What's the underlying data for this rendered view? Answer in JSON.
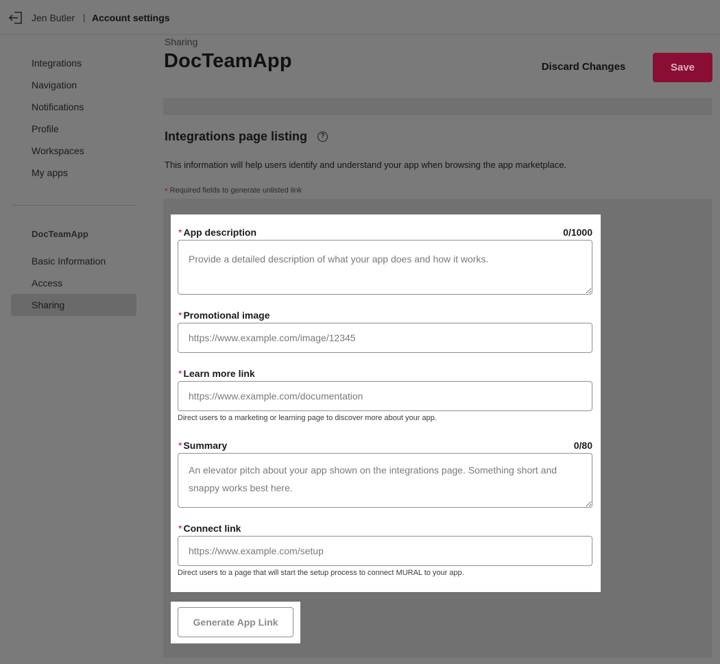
{
  "topbar": {
    "exit_icon": "exit-door-icon",
    "user_name": "Jen Butler",
    "separator": "|",
    "title": "Account settings"
  },
  "sidebar": {
    "items": [
      {
        "label": "Integrations"
      },
      {
        "label": "Navigation"
      },
      {
        "label": "Notifications"
      },
      {
        "label": "Profile"
      },
      {
        "label": "Workspaces"
      },
      {
        "label": "My apps"
      }
    ],
    "app_heading": "DocTeamApp",
    "app_items": [
      {
        "label": "Basic Information"
      },
      {
        "label": "Access"
      },
      {
        "label": "Sharing",
        "active": true
      }
    ]
  },
  "header": {
    "section": "Sharing",
    "title": "DocTeamApp",
    "discard_label": "Discard Changes",
    "save_label": "Save",
    "accent_color": "#8a0e33"
  },
  "listing": {
    "heading": "Integrations page listing",
    "help_icon": "?",
    "intro": "This information will help users identify and understand your app when browsing the app marketplace.",
    "required_star": "*",
    "required_note": "Required fields to generate unlisted link"
  },
  "form": {
    "required_star": "*",
    "app_description": {
      "label": "App description",
      "counter": "0/1000",
      "placeholder": "Provide a detailed description of what your app does and how it works.",
      "value": ""
    },
    "promotional_image": {
      "label": "Promotional image",
      "placeholder": "https://www.example.com/image/12345",
      "value": ""
    },
    "learn_more_link": {
      "label": "Learn more link",
      "placeholder": "https://www.example.com/documentation",
      "value": "",
      "hint": "Direct users to a marketing or learning page to discover more about your app."
    },
    "summary": {
      "label": "Summary",
      "counter": "0/80",
      "placeholder": "An elevator pitch about your app shown on the integrations page. Something short and snappy works best here.",
      "value": ""
    },
    "connect_link": {
      "label": "Connect link",
      "placeholder": "https://www.example.com/setup",
      "value": "",
      "hint": "Direct users to a page that will start the setup process to connect MURAL to your app."
    },
    "generate_label": "Generate App Link"
  }
}
